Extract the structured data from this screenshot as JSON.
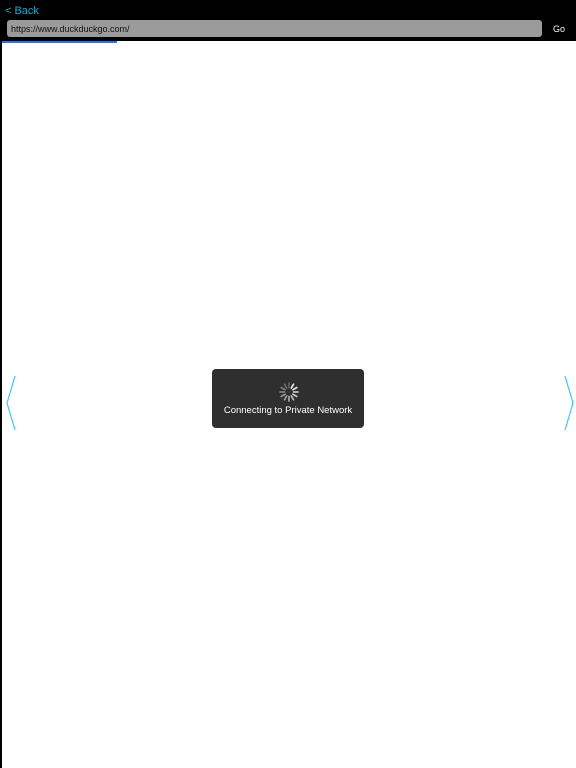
{
  "header": {
    "back_chevron": "<",
    "back_label": "Back",
    "url_value": "https://www.duckduckgo.com/",
    "go_label": "Go"
  },
  "content": {
    "load_progress": 0.2,
    "progress_color": "#2a74e8"
  },
  "nav": {
    "left_icon": "chevron-left-icon",
    "right_icon": "chevron-right-icon",
    "arrow_color": "#3fc6f0"
  },
  "loading_hud": {
    "icon": "activity-spinner-icon",
    "message": "Connecting to Private Network"
  },
  "colors": {
    "accent": "#1fa6c9",
    "chrome_background": "#000000",
    "url_field_background": "#9b9b9b",
    "hud_background": "#2f2f2f"
  }
}
